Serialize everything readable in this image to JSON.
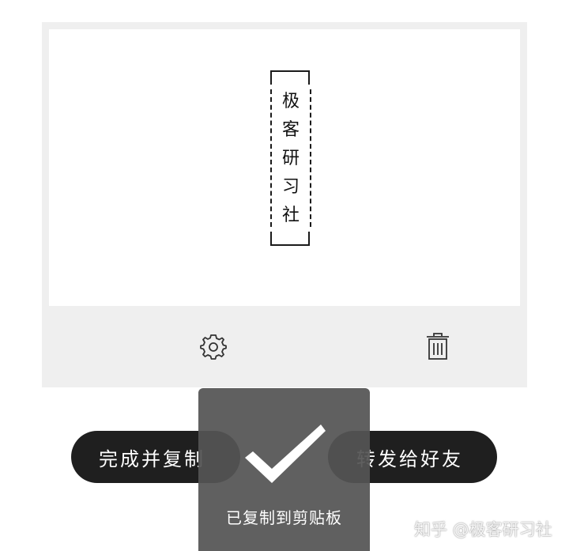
{
  "preview": {
    "vertical_text": [
      "极",
      "客",
      "研",
      "习",
      "社"
    ]
  },
  "toolbar": {
    "settings_icon": "gear-icon",
    "delete_icon": "trash-icon"
  },
  "actions": {
    "finish_copy_label": "完成并复制",
    "forward_label": "转发给好友"
  },
  "toast": {
    "message": "已复制到剪贴板",
    "icon": "checkmark-icon"
  },
  "watermark": {
    "text": "知乎 @极客研习社"
  },
  "colors": {
    "card_bg": "#efefef",
    "pill_bg": "#1f1f1f",
    "toast_bg": "#545454"
  }
}
